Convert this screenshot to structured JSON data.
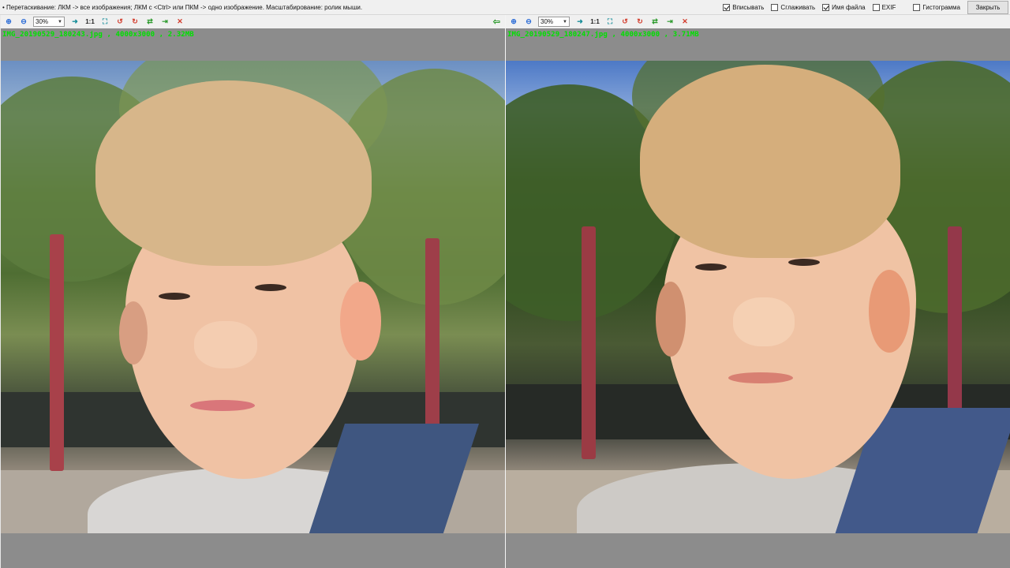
{
  "window": {
    "hint_text": "• Перетаскивание: ЛКМ -> все изображения; ЛКМ с <Ctrl> или ПКМ -> одно изображение. Масштабирование: ролик мыши.",
    "options": [
      {
        "label": "Вписывать",
        "checked": true
      },
      {
        "label": "Сглаживать",
        "checked": false
      },
      {
        "label": "Имя файла",
        "checked": true
      },
      {
        "label": "EXIF",
        "checked": false
      },
      {
        "label": "Гистограмма",
        "checked": false
      }
    ],
    "close_label": "Закрыть"
  },
  "toolbar": {
    "zoom_value": "30%",
    "actual_size_label": "1:1",
    "icons": [
      "zoom-in-icon",
      "zoom-out-icon",
      "dropdown-arrow-icon",
      "arrow-right-icon",
      "fit-icon",
      "rotate-left-icon",
      "rotate-right-icon",
      "flip-icon",
      "save-icon",
      "close-icon",
      "arrow-left-icon"
    ]
  },
  "panels": [
    {
      "file_info": "IMG_20190529_180243.jpg , 4000x3000 , 2.32MB"
    },
    {
      "file_info": "IMG_20190529_180247.jpg , 4000x3000 , 3.71MB"
    }
  ],
  "colors": {
    "file_info_text": "#00e000",
    "viewer_background": "#8c8c8c",
    "toolbar_background": "#f0f0f0"
  }
}
